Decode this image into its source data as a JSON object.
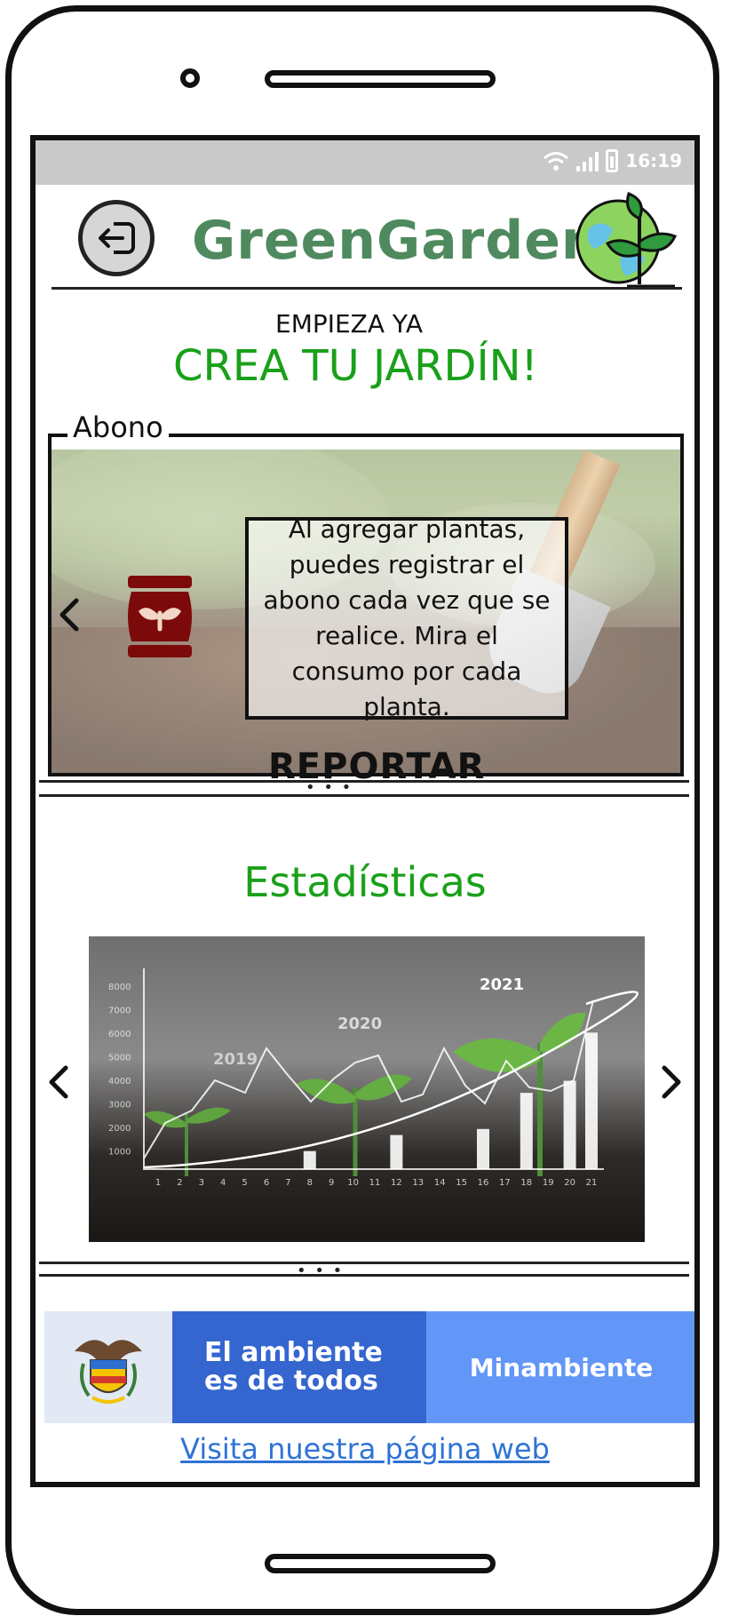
{
  "status_bar": {
    "time": "16:19"
  },
  "header": {
    "app_title": "GreenGarden"
  },
  "intro": {
    "subtitle": "EMPIEZA YA",
    "headline": "CREA TU JARDÍN!"
  },
  "abono_section": {
    "legend": "Abono",
    "description": "Al agregar plantas, puedes registrar el abono cada vez que se realice. Mira el consumo por cada planta.",
    "action_label": "REPORTAR"
  },
  "stats_section": {
    "title": "Estadísticas",
    "chart_image": {
      "year_labels": [
        "2019",
        "2020",
        "2021"
      ],
      "y_ticks": [
        "8000",
        "7000",
        "6000",
        "5000",
        "4000",
        "3000",
        "2000",
        "1000"
      ],
      "x_ticks": [
        "1",
        "2",
        "3",
        "4",
        "5",
        "6",
        "7",
        "8",
        "9",
        "10",
        "11",
        "12",
        "13",
        "14",
        "15",
        "16",
        "17",
        "18",
        "19",
        "20",
        "21"
      ]
    }
  },
  "footer": {
    "slogan_line1": "El ambiente",
    "slogan_line2": "es de todos",
    "ministry": "Minambiente",
    "link": "Visita nuestra página web"
  },
  "colors": {
    "brand_green": "#1aa01a",
    "title_green": "#4f8a5f",
    "gov_blue": "#3566cf",
    "gov_light_blue": "#6397f7",
    "link_blue": "#2f73d6"
  }
}
